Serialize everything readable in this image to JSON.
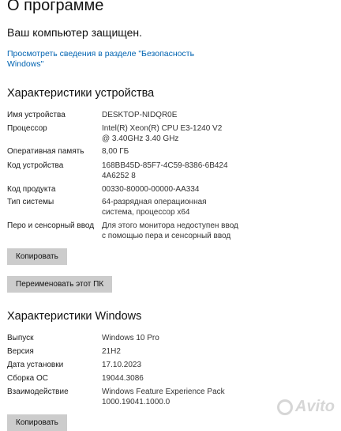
{
  "page": {
    "title": "О программе",
    "protection_status": "Ваш компьютер защищен.",
    "security_link": "Просмотреть сведения в разделе \"Безопасность Windows\""
  },
  "device": {
    "heading": "Характеристики устройства",
    "rows": [
      {
        "label": "Имя устройства",
        "value": "DESKTOP-NIDQR0E"
      },
      {
        "label": "Процессор",
        "value": "Intel(R) Xeon(R) CPU E3-1240 V2 @ 3.40GHz   3.40 GHz"
      },
      {
        "label": "Оперативная память",
        "value": "8,00 ГБ"
      },
      {
        "label": "Код устройства",
        "value": "168BB45D-85F7-4C59-8386-6B4244A6252 8"
      },
      {
        "label": "Код продукта",
        "value": "00330-80000-00000-AA334"
      },
      {
        "label": "Тип системы",
        "value": "64-разрядная операционная система, процессор x64"
      },
      {
        "label": "Перо и сенсорный ввод",
        "value": "Для этого монитора недоступен ввод с помощью пера и сенсорный ввод"
      }
    ],
    "copy_button": "Копировать",
    "rename_button": "Переименовать этот ПК"
  },
  "windows": {
    "heading": "Характеристики Windows",
    "rows": [
      {
        "label": "Выпуск",
        "value": "Windows 10 Pro"
      },
      {
        "label": "Версия",
        "value": "21H2"
      },
      {
        "label": "Дата установки",
        "value": "17.10.2023"
      },
      {
        "label": "Сборка ОС",
        "value": "19044.3086"
      },
      {
        "label": "Взаимодействие",
        "value": "Windows Feature Experience Pack 1000.19041.1000.0"
      }
    ],
    "copy_button": "Копировать"
  },
  "watermark": "Avito"
}
